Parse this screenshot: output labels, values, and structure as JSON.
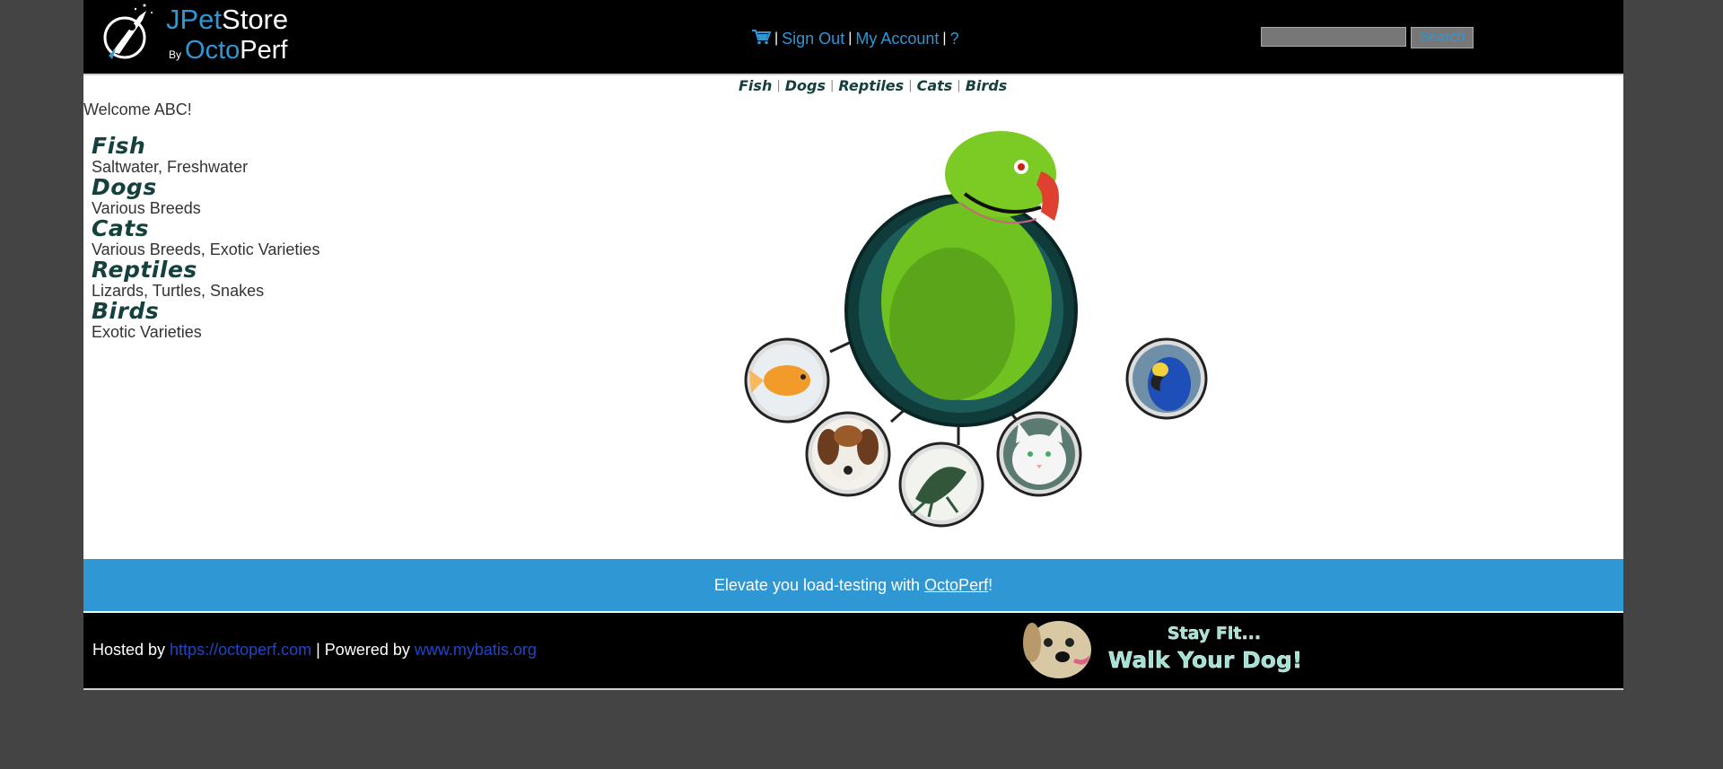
{
  "header": {
    "logo": {
      "line1_a": "JPet",
      "line1_b": "Store",
      "by": "By",
      "line2_a": "Octo",
      "line2_b": "Perf"
    },
    "menu": {
      "cart_icon": "cart-icon",
      "sep": "|",
      "sign_out": "Sign Out",
      "my_account": "My Account",
      "help": "?"
    },
    "search": {
      "value": "",
      "button_label": "Search"
    }
  },
  "quick_links": [
    "Fish",
    "Dogs",
    "Reptiles",
    "Cats",
    "Birds"
  ],
  "quick_link_sep": "|",
  "welcome": "Welcome ABC!",
  "sidebar": [
    {
      "title": "Fish",
      "desc": "Saltwater, Freshwater"
    },
    {
      "title": "Dogs",
      "desc": "Various Breeds"
    },
    {
      "title": "Cats",
      "desc": "Various Breeds, Exotic Varieties"
    },
    {
      "title": "Reptiles",
      "desc": "Lizards, Turtles, Snakes"
    },
    {
      "title": "Birds",
      "desc": "Exotic Varieties"
    }
  ],
  "banner": {
    "prefix": "Elevate you load-testing with ",
    "link": "OctoPerf",
    "suffix": "!"
  },
  "footer": {
    "hosted_by": "Hosted by ",
    "hosted_link": "https://octoperf.com",
    "powered_by": " | Powered by ",
    "powered_link": "www.mybatis.org",
    "ad_line1": "Stay Fit...",
    "ad_line2": "Walk Your Dog!"
  },
  "colors": {
    "accent": "#2e97d4",
    "background": "#444444",
    "header": "#000000",
    "category_text": "#15403d"
  }
}
